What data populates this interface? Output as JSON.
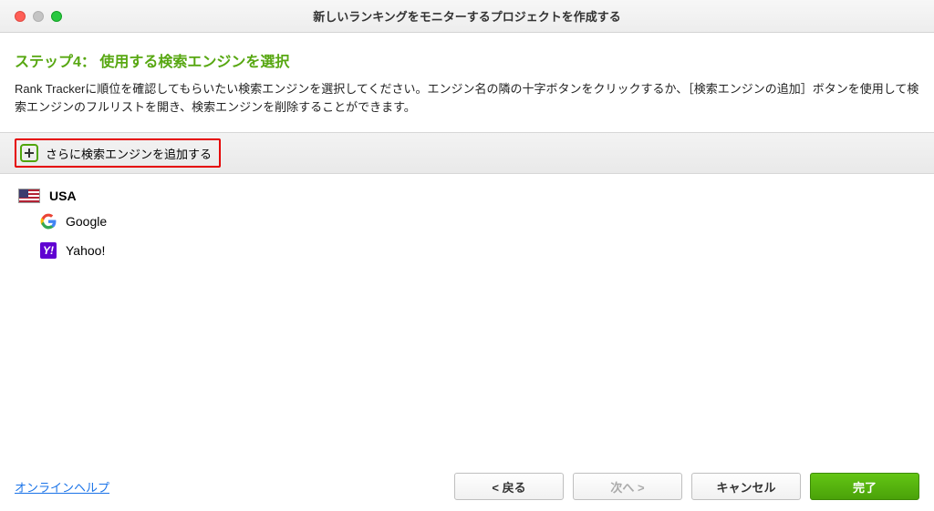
{
  "window": {
    "title": "新しいランキングをモニターするプロジェクトを作成する"
  },
  "step": {
    "title": "ステップ4： 使用する検索エンジンを選択",
    "description": "Rank Trackerに順位を確認してもらいたい検索エンジンを選択してください。エンジン名の隣の十字ボタンをクリックするか、［検索エンジンの追加］ボタンを使用して検索エンジンのフルリストを開き、検索エンジンを削除することができます。"
  },
  "toolbar": {
    "add_label": "さらに検索エンジンを追加する"
  },
  "engines": {
    "country": {
      "code": "US",
      "name": "USA"
    },
    "items": [
      {
        "name": "Google"
      },
      {
        "name": "Yahoo!"
      }
    ]
  },
  "footer": {
    "help": "オンラインヘルプ",
    "back": "< 戻る",
    "next": "次へ >",
    "cancel": "キャンセル",
    "finish": "完了"
  }
}
